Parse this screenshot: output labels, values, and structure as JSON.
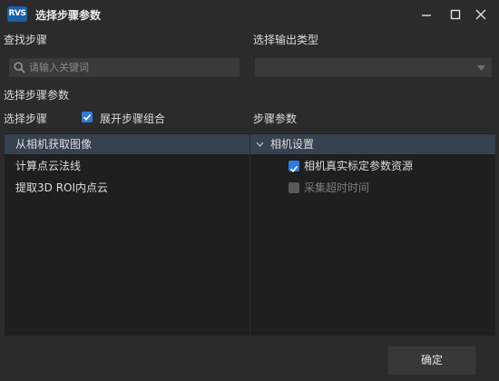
{
  "window": {
    "logo_text": "RVS",
    "title": "选择步骤参数"
  },
  "find_step": {
    "label": "查找步骤",
    "search_placeholder": "请输入关键词",
    "search_value": ""
  },
  "output_type": {
    "label": "选择输出类型",
    "selected": ""
  },
  "section_title": "选择步骤参数",
  "steps": {
    "label": "选择步骤",
    "expand_checkbox_label": "展开步骤组合",
    "expand_checked": true,
    "items": [
      {
        "label": "从相机获取图像",
        "selected": true
      },
      {
        "label": "计算点云法线",
        "selected": false
      },
      {
        "label": "提取3D ROI内点云",
        "selected": false
      }
    ]
  },
  "params": {
    "label": "步骤参数",
    "group": {
      "label": "相机设置",
      "expanded": true,
      "items": [
        {
          "label": "相机真实标定参数资源",
          "checked": true,
          "enabled": true
        },
        {
          "label": "采集超时时间",
          "checked": false,
          "enabled": false
        }
      ]
    }
  },
  "footer": {
    "ok_label": "确定"
  },
  "colors": {
    "window_bg": "#2b2b2b",
    "panel_bg": "#1f1f1f",
    "selection_bg": "#364250",
    "accent": "#2f7ad9",
    "logo": "#1d5fa8"
  }
}
